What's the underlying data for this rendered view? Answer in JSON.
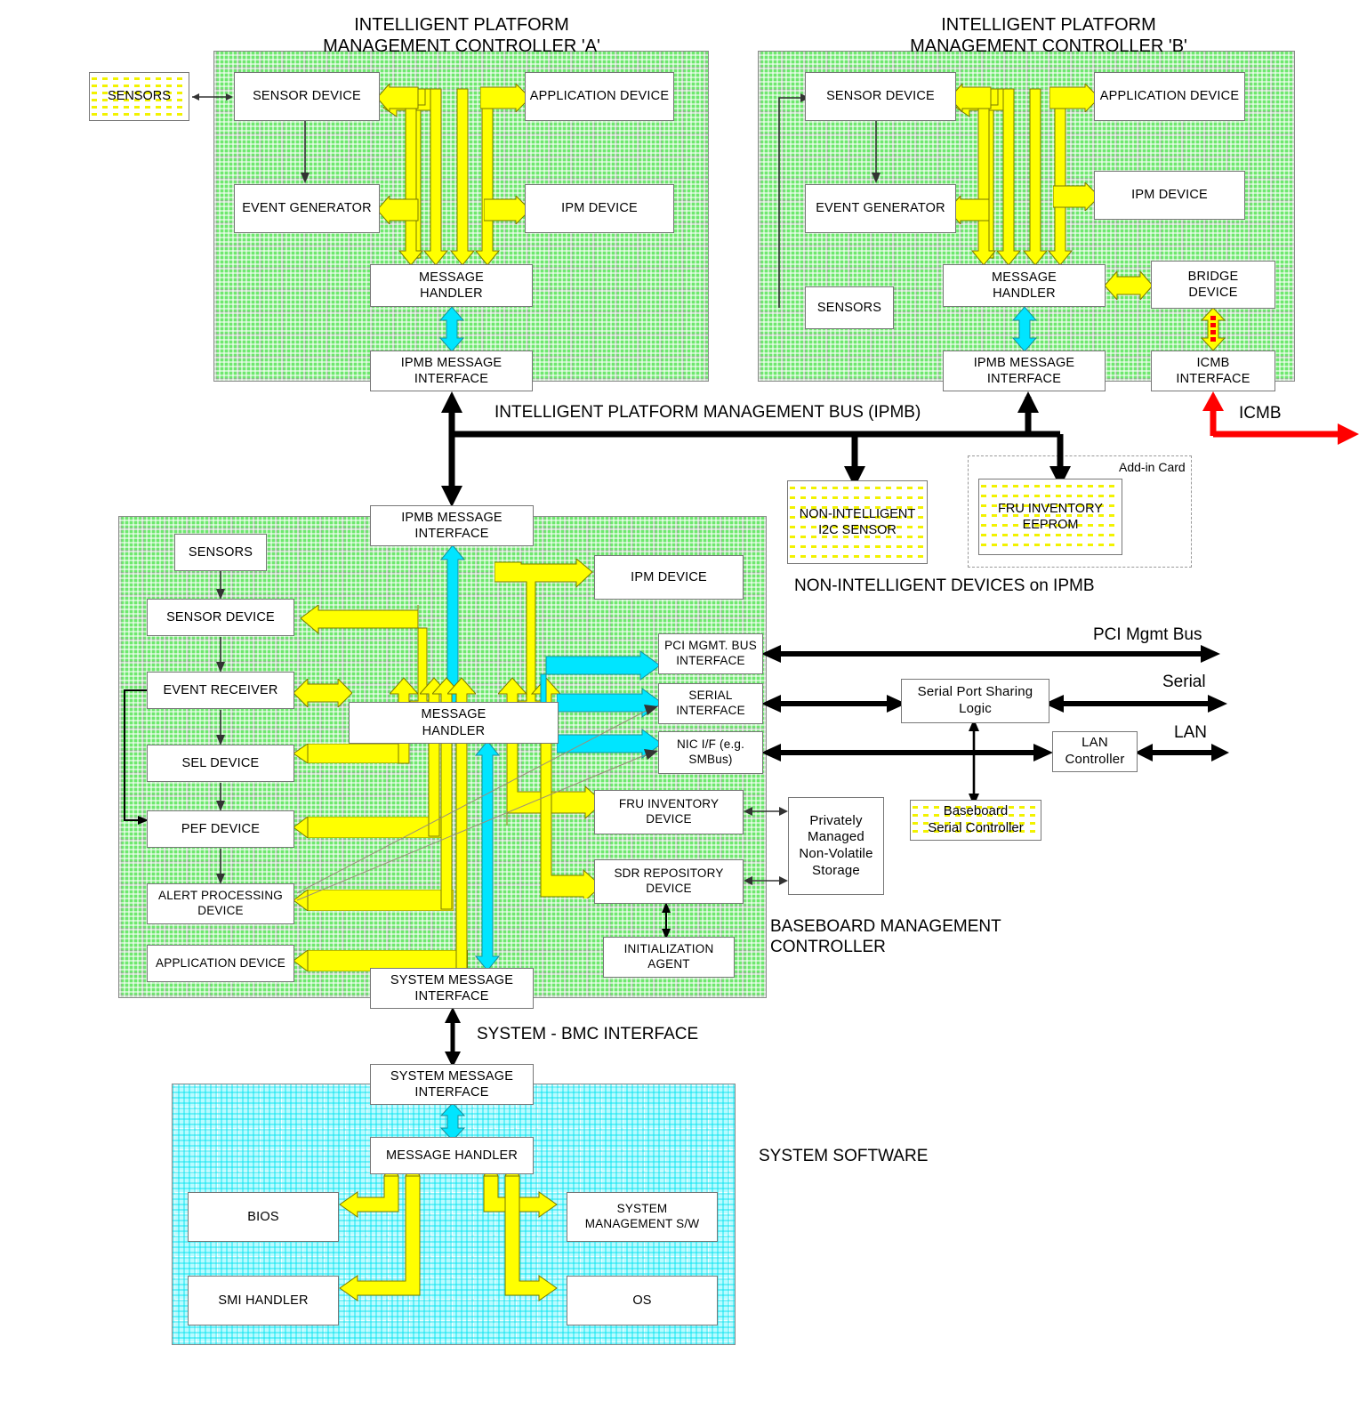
{
  "titles": {
    "ipmc_a": "INTELLIGENT PLATFORM\nMANAGEMENT CONTROLLER 'A'",
    "ipmc_b": "INTELLIGENT PLATFORM\nMANAGEMENT CONTROLLER 'B'",
    "ipmb_bus": "INTELLIGENT PLATFORM MANAGEMENT BUS (IPMB)",
    "icmb": "ICMB",
    "non_intelligent_devices": "NON-INTELLIGENT DEVICES on IPMB",
    "add_in_card": "Add-in Card",
    "pci_mgmt_bus": "PCI Mgmt Bus",
    "serial": "Serial",
    "lan": "LAN",
    "bmc": "BASEBOARD MANAGEMENT\nCONTROLLER",
    "system_bmc_interface": "SYSTEM - BMC INTERFACE",
    "system_software": "SYSTEM SOFTWARE"
  },
  "ipmc_a": {
    "sensors_external": "SENSORS",
    "sensor_device": "SENSOR DEVICE",
    "application_device": "APPLICATION DEVICE",
    "event_generator": "EVENT GENERATOR",
    "ipm_device": "IPM DEVICE",
    "message_handler": "MESSAGE\nHANDLER",
    "ipmb_message_interface": "IPMB MESSAGE\nINTERFACE"
  },
  "ipmc_b": {
    "sensor_device": "SENSOR DEVICE",
    "application_device": "APPLICATION DEVICE",
    "event_generator": "EVENT GENERATOR",
    "ipm_device": "IPM DEVICE",
    "sensors": "SENSORS",
    "message_handler": "MESSAGE\nHANDLER",
    "bridge_device": "BRIDGE\nDEVICE",
    "ipmb_message_interface": "IPMB MESSAGE\nINTERFACE",
    "icmb_interface": "ICMB\nINTERFACE"
  },
  "non_intelligent": {
    "i2c_sensor": "NON-INTELLIGENT\nI2C SENSOR",
    "fru_eeprom": "FRU INVENTORY\nEEPROM"
  },
  "bmc": {
    "ipmb_message_interface": "IPMB MESSAGE\nINTERFACE",
    "sensors": "SENSORS",
    "sensor_device": "SENSOR DEVICE",
    "event_receiver": "EVENT RECEIVER",
    "sel_device": "SEL DEVICE",
    "pef_device": "PEF DEVICE",
    "alert_processing_device": "ALERT PROCESSING\nDEVICE",
    "application_device": "APPLICATION DEVICE",
    "message_handler": "MESSAGE\nHANDLER",
    "ipm_device": "IPM DEVICE",
    "pci_mgmt_bus_interface": "PCI MGMT. BUS\nINTERFACE",
    "serial_interface": "SERIAL\nINTERFACE",
    "nic_interface": "NIC I/F (e.g.\nSMBus)",
    "fru_inventory_device": "FRU INVENTORY\nDEVICE",
    "sdr_repository_device": "SDR REPOSITORY\nDEVICE",
    "initialization_agent": "INITIALIZATION\nAGENT",
    "system_message_interface": "SYSTEM MESSAGE\nINTERFACE",
    "privately_managed_storage": "Privately\nManaged\nNon-Volatile\nStorage",
    "serial_port_sharing_logic": "Serial Port Sharing\nLogic",
    "lan_controller": "LAN\nController",
    "baseboard_serial_controller": "Baseboard\nSerial Controller"
  },
  "system_software": {
    "system_message_interface": "SYSTEM MESSAGE\nINTERFACE",
    "message_handler": "MESSAGE HANDLER",
    "bios": "BIOS",
    "system_management_sw": "SYSTEM\nMANAGEMENT S/W",
    "smi_handler": "SMI HANDLER",
    "os": "OS"
  },
  "colors": {
    "panel_green": "#6ee86e",
    "panel_cyan": "#b9fbff",
    "arrow_yellow": "#ffff00",
    "arrow_cyan": "#00e5ff",
    "icmb_red": "#ff0000",
    "box_white": "#ffffff",
    "dot_yellow": "#f2f200"
  }
}
